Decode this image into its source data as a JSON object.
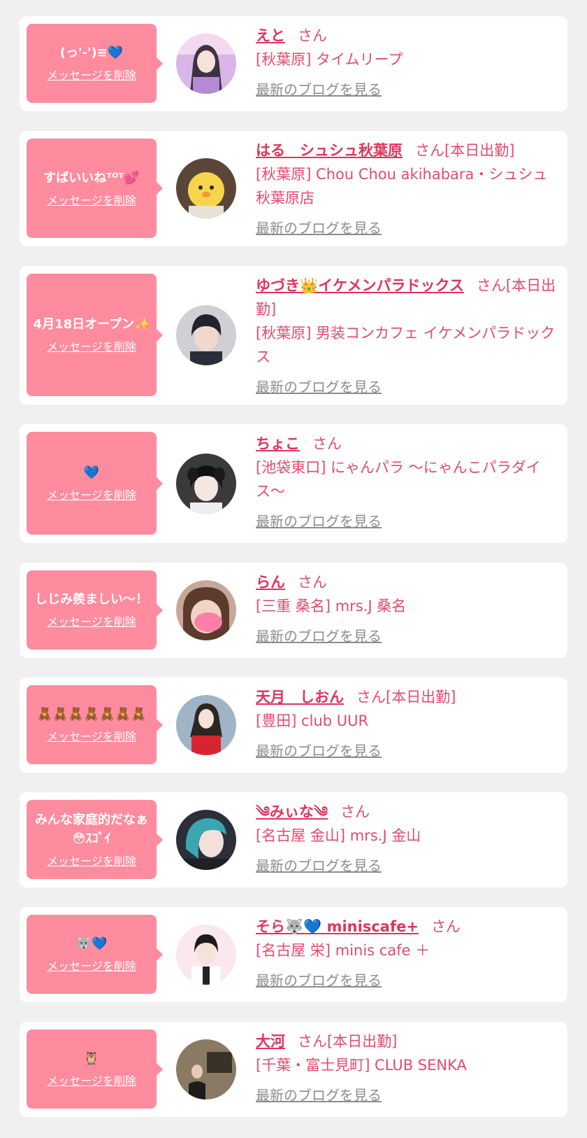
{
  "delete_label": "メッセージを削除",
  "blog_label": "最新のブログを見る",
  "colors": {
    "background": "#f0f0f0",
    "card": "#ffffff",
    "bubble": "#fe8b9e",
    "name": "#e0335d",
    "text": "#e14b6e",
    "link_gray": "#8c8c8c"
  },
  "items": [
    {
      "message": "(っ'-')≡💙",
      "name": "えと",
      "suffix": "さん",
      "shop": "[秋葉原] タイムリープ",
      "avatar_icon": "avatar-photo"
    },
    {
      "message": "すばいいねᵀᴼᵀ💕",
      "name": "はる　シュシュ秋葉原",
      "suffix": "さん[本日出勤]",
      "shop": "[秋葉原] Chou Chou akihabara・シュシュ秋葉原店",
      "avatar_icon": "avatar-photo"
    },
    {
      "message": "4月18日オープン✨",
      "name": "ゆづき👑イケメンパラドックス",
      "suffix": "さん[本日出勤]",
      "shop": "[秋葉原] 男装コンカフェ イケメンパラドックス",
      "avatar_icon": "avatar-photo"
    },
    {
      "message": "💙",
      "name": "ちょこ",
      "suffix": "さん",
      "shop": "[池袋東口] にゃんパラ 〜にゃんこパラダイス〜",
      "avatar_icon": "avatar-photo"
    },
    {
      "message": "しじみ羨ましい〜！",
      "name": "らん",
      "suffix": "さん",
      "shop": "[三重 桑名] mrs.J 桑名",
      "avatar_icon": "avatar-photo"
    },
    {
      "message": "🧸🧸🧸🧸🧸🧸🧸",
      "name": "天月　しおん",
      "suffix": "さん[本日出勤]",
      "shop": "[豊田] club UUR",
      "avatar_icon": "avatar-photo"
    },
    {
      "message": "みんな家庭的だなぁ😳ｽｺﾞｲ",
      "name": "༄みぃな༄",
      "suffix": "さん",
      "shop": "[名古屋 金山] mrs.J 金山",
      "avatar_icon": "avatar-photo"
    },
    {
      "message": "🐺💙",
      "name": "そら🐺💙 miniscafe+",
      "suffix": "さん",
      "shop": "[名古屋 栄] minis cafe ＋",
      "avatar_icon": "avatar-photo"
    },
    {
      "message": "🦉",
      "name": "大河",
      "suffix": "さん[本日出勤]",
      "shop": "[千葉・富士見町] CLUB SENKA",
      "avatar_icon": "avatar-photo"
    }
  ]
}
